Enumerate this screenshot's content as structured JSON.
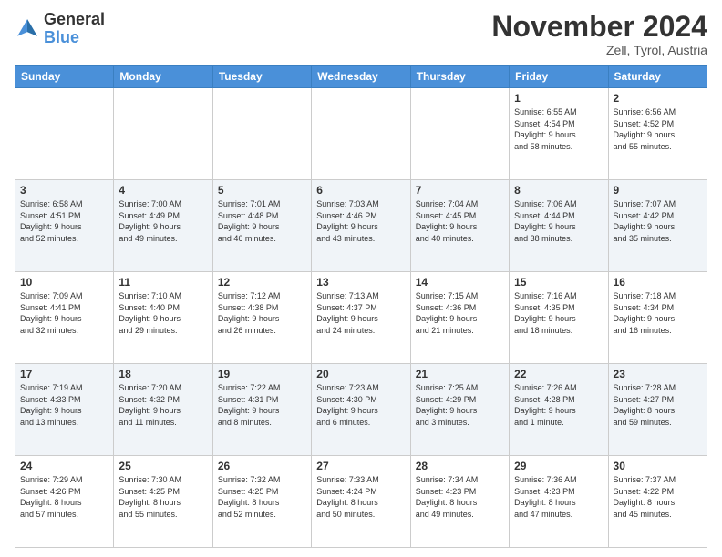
{
  "logo": {
    "line1": "General",
    "line2": "Blue"
  },
  "header": {
    "month": "November 2024",
    "location": "Zell, Tyrol, Austria"
  },
  "weekdays": [
    "Sunday",
    "Monday",
    "Tuesday",
    "Wednesday",
    "Thursday",
    "Friday",
    "Saturday"
  ],
  "weeks": [
    [
      {
        "day": "",
        "info": ""
      },
      {
        "day": "",
        "info": ""
      },
      {
        "day": "",
        "info": ""
      },
      {
        "day": "",
        "info": ""
      },
      {
        "day": "",
        "info": ""
      },
      {
        "day": "1",
        "info": "Sunrise: 6:55 AM\nSunset: 4:54 PM\nDaylight: 9 hours\nand 58 minutes."
      },
      {
        "day": "2",
        "info": "Sunrise: 6:56 AM\nSunset: 4:52 PM\nDaylight: 9 hours\nand 55 minutes."
      }
    ],
    [
      {
        "day": "3",
        "info": "Sunrise: 6:58 AM\nSunset: 4:51 PM\nDaylight: 9 hours\nand 52 minutes."
      },
      {
        "day": "4",
        "info": "Sunrise: 7:00 AM\nSunset: 4:49 PM\nDaylight: 9 hours\nand 49 minutes."
      },
      {
        "day": "5",
        "info": "Sunrise: 7:01 AM\nSunset: 4:48 PM\nDaylight: 9 hours\nand 46 minutes."
      },
      {
        "day": "6",
        "info": "Sunrise: 7:03 AM\nSunset: 4:46 PM\nDaylight: 9 hours\nand 43 minutes."
      },
      {
        "day": "7",
        "info": "Sunrise: 7:04 AM\nSunset: 4:45 PM\nDaylight: 9 hours\nand 40 minutes."
      },
      {
        "day": "8",
        "info": "Sunrise: 7:06 AM\nSunset: 4:44 PM\nDaylight: 9 hours\nand 38 minutes."
      },
      {
        "day": "9",
        "info": "Sunrise: 7:07 AM\nSunset: 4:42 PM\nDaylight: 9 hours\nand 35 minutes."
      }
    ],
    [
      {
        "day": "10",
        "info": "Sunrise: 7:09 AM\nSunset: 4:41 PM\nDaylight: 9 hours\nand 32 minutes."
      },
      {
        "day": "11",
        "info": "Sunrise: 7:10 AM\nSunset: 4:40 PM\nDaylight: 9 hours\nand 29 minutes."
      },
      {
        "day": "12",
        "info": "Sunrise: 7:12 AM\nSunset: 4:38 PM\nDaylight: 9 hours\nand 26 minutes."
      },
      {
        "day": "13",
        "info": "Sunrise: 7:13 AM\nSunset: 4:37 PM\nDaylight: 9 hours\nand 24 minutes."
      },
      {
        "day": "14",
        "info": "Sunrise: 7:15 AM\nSunset: 4:36 PM\nDaylight: 9 hours\nand 21 minutes."
      },
      {
        "day": "15",
        "info": "Sunrise: 7:16 AM\nSunset: 4:35 PM\nDaylight: 9 hours\nand 18 minutes."
      },
      {
        "day": "16",
        "info": "Sunrise: 7:18 AM\nSunset: 4:34 PM\nDaylight: 9 hours\nand 16 minutes."
      }
    ],
    [
      {
        "day": "17",
        "info": "Sunrise: 7:19 AM\nSunset: 4:33 PM\nDaylight: 9 hours\nand 13 minutes."
      },
      {
        "day": "18",
        "info": "Sunrise: 7:20 AM\nSunset: 4:32 PM\nDaylight: 9 hours\nand 11 minutes."
      },
      {
        "day": "19",
        "info": "Sunrise: 7:22 AM\nSunset: 4:31 PM\nDaylight: 9 hours\nand 8 minutes."
      },
      {
        "day": "20",
        "info": "Sunrise: 7:23 AM\nSunset: 4:30 PM\nDaylight: 9 hours\nand 6 minutes."
      },
      {
        "day": "21",
        "info": "Sunrise: 7:25 AM\nSunset: 4:29 PM\nDaylight: 9 hours\nand 3 minutes."
      },
      {
        "day": "22",
        "info": "Sunrise: 7:26 AM\nSunset: 4:28 PM\nDaylight: 9 hours\nand 1 minute."
      },
      {
        "day": "23",
        "info": "Sunrise: 7:28 AM\nSunset: 4:27 PM\nDaylight: 8 hours\nand 59 minutes."
      }
    ],
    [
      {
        "day": "24",
        "info": "Sunrise: 7:29 AM\nSunset: 4:26 PM\nDaylight: 8 hours\nand 57 minutes."
      },
      {
        "day": "25",
        "info": "Sunrise: 7:30 AM\nSunset: 4:25 PM\nDaylight: 8 hours\nand 55 minutes."
      },
      {
        "day": "26",
        "info": "Sunrise: 7:32 AM\nSunset: 4:25 PM\nDaylight: 8 hours\nand 52 minutes."
      },
      {
        "day": "27",
        "info": "Sunrise: 7:33 AM\nSunset: 4:24 PM\nDaylight: 8 hours\nand 50 minutes."
      },
      {
        "day": "28",
        "info": "Sunrise: 7:34 AM\nSunset: 4:23 PM\nDaylight: 8 hours\nand 49 minutes."
      },
      {
        "day": "29",
        "info": "Sunrise: 7:36 AM\nSunset: 4:23 PM\nDaylight: 8 hours\nand 47 minutes."
      },
      {
        "day": "30",
        "info": "Sunrise: 7:37 AM\nSunset: 4:22 PM\nDaylight: 8 hours\nand 45 minutes."
      }
    ]
  ]
}
